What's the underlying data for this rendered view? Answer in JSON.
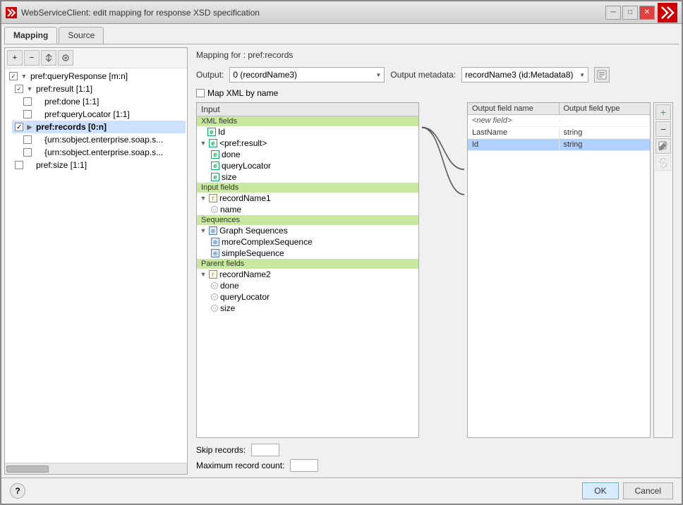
{
  "window": {
    "title": "WebServiceClient: edit mapping for response XSD specification",
    "icon": "✕"
  },
  "titleButtons": {
    "minimize": "─",
    "maximize": "□",
    "close": "✕"
  },
  "tabs": [
    {
      "label": "Mapping",
      "active": true
    },
    {
      "label": "Source",
      "active": false
    }
  ],
  "toolbar": {
    "add": "+",
    "remove": "─",
    "move": "↕",
    "props": "⚙"
  },
  "treeItems": [
    {
      "indent": 0,
      "label": "pref:queryResponse [m:n]",
      "checked": true,
      "bold": false,
      "hasExpander": true,
      "expanded": true
    },
    {
      "indent": 1,
      "label": "pref:result [1:1]",
      "checked": true,
      "bold": false,
      "hasExpander": true,
      "expanded": true
    },
    {
      "indent": 2,
      "label": "pref:done [1:1]",
      "checked": false,
      "bold": false,
      "hasExpander": false
    },
    {
      "indent": 2,
      "label": "pref:queryLocator [1:1]",
      "checked": false,
      "bold": false,
      "hasExpander": false
    },
    {
      "indent": 1,
      "label": "pref:records [0:n]",
      "checked": true,
      "bold": true,
      "hasExpander": true,
      "expanded": false,
      "selected": true
    },
    {
      "indent": 2,
      "label": "{urn:sobject.enterprise.soap.s...",
      "checked": false,
      "bold": false,
      "hasExpander": false
    },
    {
      "indent": 2,
      "label": "{urn:sobject.enterprise.soap.s...",
      "checked": false,
      "bold": false,
      "hasExpander": false
    },
    {
      "indent": 1,
      "label": "pref:size [1:1]",
      "checked": false,
      "bold": false,
      "hasExpander": false
    }
  ],
  "mappingFor": "Mapping for : pref:records",
  "output": {
    "label": "Output:",
    "value": "0 (recordName3)",
    "placeholder": "0 (recordName3)"
  },
  "outputMetadata": {
    "label": "Output metadata:",
    "value": "recordName3 (id:Metadata8)"
  },
  "mapXMLByName": "Map XML by name",
  "inputPanel": {
    "header": "Input",
    "sections": [
      {
        "type": "section-header",
        "label": "XML fields"
      },
      {
        "indent": 0,
        "label": "Id",
        "icon": "e"
      },
      {
        "indent": 0,
        "label": "<pref:result>",
        "icon": "e",
        "hasExpander": true
      },
      {
        "indent": 1,
        "label": "done",
        "icon": "e"
      },
      {
        "indent": 1,
        "label": "queryLocator",
        "icon": "e"
      },
      {
        "indent": 1,
        "label": "size",
        "icon": "e"
      },
      {
        "type": "section-header",
        "label": "Input fields"
      },
      {
        "indent": 0,
        "label": "recordName1",
        "icon": "r",
        "hasExpander": true
      },
      {
        "indent": 1,
        "label": "name",
        "icon": "o"
      },
      {
        "type": "section-header",
        "label": "Sequences"
      },
      {
        "indent": 0,
        "label": "Graph Sequences",
        "icon": "s",
        "hasExpander": true
      },
      {
        "indent": 1,
        "label": "moreComplexSequence",
        "icon": "s2"
      },
      {
        "indent": 1,
        "label": "simpleSequence",
        "icon": "s2"
      },
      {
        "type": "section-header",
        "label": "Parent fields"
      },
      {
        "indent": 0,
        "label": "recordName2",
        "icon": "r",
        "hasExpander": true
      },
      {
        "indent": 1,
        "label": "done",
        "icon": "o"
      },
      {
        "indent": 1,
        "label": "queryLocator",
        "icon": "o"
      },
      {
        "indent": 1,
        "label": "size",
        "icon": "o"
      }
    ]
  },
  "outputPanel": {
    "columns": [
      "Output field name",
      "Output field type"
    ],
    "rows": [
      {
        "name": "<new field>",
        "type": "",
        "italic": true,
        "selected": false
      },
      {
        "name": "LastName",
        "type": "string",
        "italic": false,
        "selected": false
      },
      {
        "name": "Id",
        "type": "string",
        "italic": false,
        "selected": true
      }
    ]
  },
  "rightToolbar": {
    "add": "+",
    "remove": "−",
    "edit": "✎",
    "link": "⌘"
  },
  "skipRecords": {
    "label": "Skip records:",
    "value": ""
  },
  "maxRecordCount": {
    "label": "Maximum record count:",
    "value": ""
  },
  "buttons": {
    "help": "?",
    "ok": "OK",
    "cancel": "Cancel"
  }
}
